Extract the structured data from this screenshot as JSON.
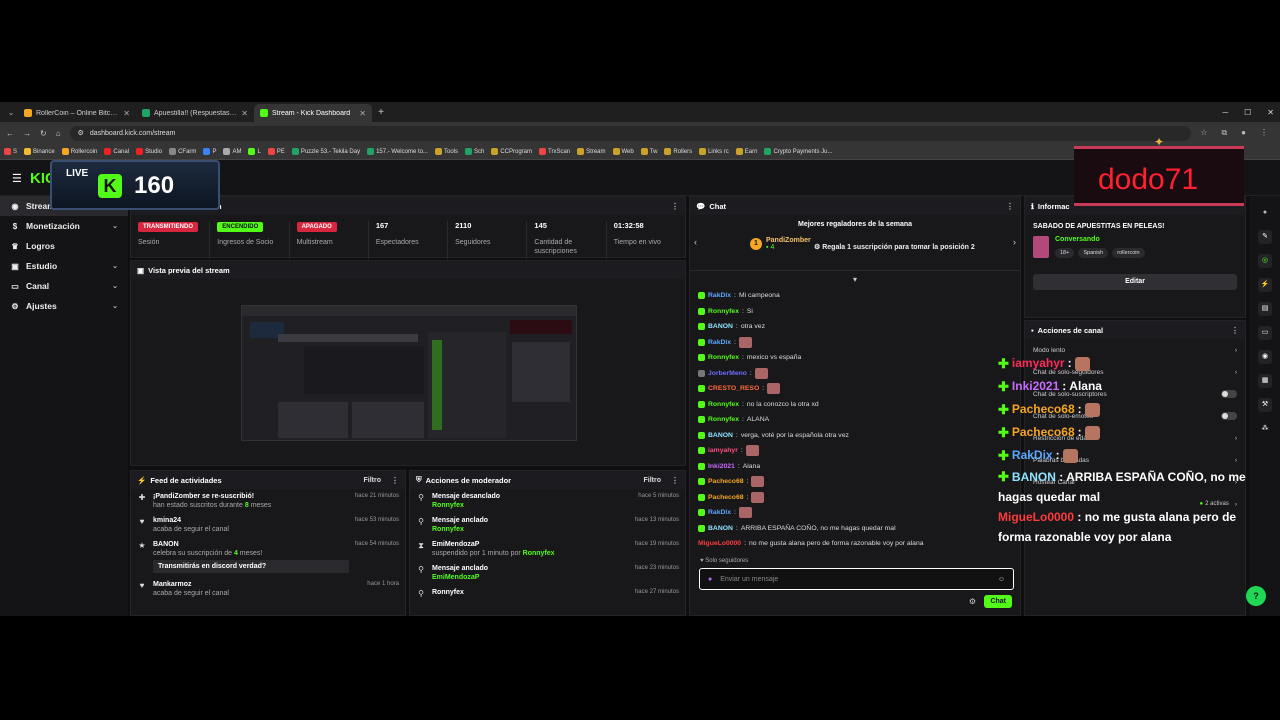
{
  "browser": {
    "tabs": [
      {
        "title": "RollerCoin – Online Bitcoin Mi",
        "color": "#f5a623",
        "active": false
      },
      {
        "title": "Apuestilla!! (Respuestas) - Hoj",
        "color": "#1fa463",
        "active": false
      },
      {
        "title": "Stream - Kick Dashboard",
        "color": "#53fc18",
        "active": true
      }
    ],
    "url": "dashboard.kick.com/stream",
    "bookmarks": [
      {
        "label": "S",
        "color": "#e44"
      },
      {
        "label": "Binance",
        "color": "#f3ba2f"
      },
      {
        "label": "Rollercoin",
        "color": "#f5a623"
      },
      {
        "label": "Canal",
        "color": "#e22"
      },
      {
        "label": "Studio",
        "color": "#e22"
      },
      {
        "label": "CFarm",
        "color": "#888"
      },
      {
        "label": "P",
        "color": "#3b82f6"
      },
      {
        "label": "AM",
        "color": "#aaa"
      },
      {
        "label": "L",
        "color": "#53fc18"
      },
      {
        "label": "PE",
        "color": "#e44"
      },
      {
        "label": "Puzzle 53.- Tekila Day",
        "color": "#1fa463"
      },
      {
        "label": "157.- Welcome to...",
        "color": "#1fa463"
      },
      {
        "label": "Tools",
        "color": "#c9a227"
      },
      {
        "label": "Sch",
        "color": "#1fa463"
      },
      {
        "label": "CCProgram",
        "color": "#c9a227"
      },
      {
        "label": "TrxScan",
        "color": "#e44"
      },
      {
        "label": "Stream",
        "color": "#c9a227"
      },
      {
        "label": "Web",
        "color": "#c9a227"
      },
      {
        "label": "Tw",
        "color": "#c9a227"
      },
      {
        "label": "Rollers",
        "color": "#c9a227"
      },
      {
        "label": "Links rc",
        "color": "#c9a227"
      },
      {
        "label": "Earn",
        "color": "#c9a227"
      },
      {
        "label": "Crypto Payments Ju...",
        "color": "#1fa463"
      }
    ]
  },
  "sidebar": {
    "items": [
      {
        "label": "Stream",
        "icon": "broadcast-icon",
        "active": true,
        "chevron": false
      },
      {
        "label": "Monetización",
        "icon": "money-icon",
        "active": false,
        "chevron": true
      },
      {
        "label": "Logros",
        "icon": "trophy-icon",
        "active": false,
        "chevron": false
      },
      {
        "label": "Estudio",
        "icon": "studio-icon",
        "active": false,
        "chevron": true
      },
      {
        "label": "Canal",
        "icon": "channel-icon",
        "active": false,
        "chevron": true
      },
      {
        "label": "Ajustes",
        "icon": "gear-icon",
        "active": false,
        "chevron": true
      }
    ]
  },
  "session": {
    "header": "n",
    "stats": [
      {
        "value": "TRANSMITIENDO",
        "pill": "red",
        "label": "Sesión"
      },
      {
        "value": "ENCENDIDO",
        "pill": "green",
        "label": "Ingresos de Socio"
      },
      {
        "value": "APAGADO",
        "pill": "red",
        "label": "Multistream"
      },
      {
        "value": "167",
        "pill": "",
        "label": "Espectadores"
      },
      {
        "value": "2110",
        "pill": "",
        "label": "Seguidores"
      },
      {
        "value": "145",
        "pill": "",
        "label": "Cantidad de suscripciones"
      },
      {
        "value": "01:32:58",
        "pill": "",
        "label": "Tiempo en vivo"
      }
    ]
  },
  "preview": {
    "title": "Vista previa del stream"
  },
  "feed": {
    "title": "Feed de actividades",
    "filter": "Filtro",
    "items": [
      {
        "icon": "gift-icon",
        "title": "¡PandiZomber se re-suscribió!",
        "sub_pre": "han estado suscritos durante ",
        "sub_hl": "8",
        "sub_post": " meses",
        "time": "hace 21 minutos",
        "quote": ""
      },
      {
        "icon": "heart-icon",
        "title": "kmina24",
        "sub_pre": "acaba de seguir el canal",
        "sub_hl": "",
        "sub_post": "",
        "time": "hace 53 minutos",
        "quote": ""
      },
      {
        "icon": "star-icon",
        "title": "BANON",
        "sub_pre": "celebra su suscripción de ",
        "sub_hl": "4",
        "sub_post": " meses!",
        "time": "hace 54 minutos",
        "quote": "Transmitirás en discord verdad?"
      },
      {
        "icon": "heart-icon",
        "title": "Mankarmoz",
        "sub_pre": "acaba de seguir el canal",
        "sub_hl": "",
        "sub_post": "",
        "time": "hace 1 hora",
        "quote": ""
      }
    ]
  },
  "modactions": {
    "title": "Acciones de moderador",
    "filter": "Filtro",
    "items": [
      {
        "icon": "unpin-icon",
        "title": "Mensaje desanclado",
        "sub_pre": "",
        "sub_hl": "Ronnyfex",
        "sub_post": "",
        "time": "hace 5 minutos"
      },
      {
        "icon": "pin-icon",
        "title": "Mensaje anclado",
        "sub_pre": "",
        "sub_hl": "Ronnyfex",
        "sub_post": "",
        "time": "hace 13 minutos"
      },
      {
        "icon": "hourglass-icon",
        "title": "EmiMendozaP",
        "sub_pre": "suspendido por 1 minuto por ",
        "sub_hl": "Ronnyfex",
        "sub_post": "",
        "time": "hace 19 minutos"
      },
      {
        "icon": "pin-icon",
        "title": "Mensaje anclado",
        "sub_pre": "",
        "sub_hl": "EmiMendozaP",
        "sub_post": "",
        "time": "hace 23 minutos"
      },
      {
        "icon": "pin-icon",
        "title": "Ronnyfex",
        "sub_pre": "",
        "sub_hl": "",
        "sub_post": "",
        "time": "hace 27 minutos"
      }
    ]
  },
  "chat": {
    "title": "Chat",
    "gifters_title": "Mejores regaladores de la semana",
    "gifter_rank": "1",
    "gifter_name": "PandiZomber",
    "gifter_count": "4",
    "gift_prompt": "Regala 1 suscripción para tomar la posición 2",
    "messages": [
      {
        "user": "RakDix",
        "color": "#5aa9ff",
        "badge": "#53fc18",
        "text": "Mi campeona",
        "emote": false
      },
      {
        "user": "Ronnyfex",
        "color": "#53fc18",
        "badge": "#53fc18",
        "text": "Si",
        "emote": false
      },
      {
        "user": "BANON",
        "color": "#8fe3ff",
        "badge": "#53fc18",
        "text": "otra vez",
        "emote": false
      },
      {
        "user": "RakDix",
        "color": "#5aa9ff",
        "badge": "#53fc18",
        "text": "",
        "emote": true
      },
      {
        "user": "Ronnyfex",
        "color": "#53fc18",
        "badge": "#53fc18",
        "text": "mexico vs españa",
        "emote": false
      },
      {
        "user": "JorberMeno",
        "color": "#6c6cff",
        "badge": "#777",
        "text": "",
        "emote": true
      },
      {
        "user": "CRESTO_RESO",
        "color": "#ff6a3d",
        "badge": "#53fc18",
        "text": "",
        "emote": true
      },
      {
        "user": "Ronnyfex",
        "color": "#53fc18",
        "badge": "#53fc18",
        "text": "no la conozco la otra xd",
        "emote": false
      },
      {
        "user": "Ronnyfex",
        "color": "#53fc18",
        "badge": "#53fc18",
        "text": "ALANA",
        "emote": false
      },
      {
        "user": "BANON",
        "color": "#8fe3ff",
        "badge": "#53fc18",
        "text": "verga, voté por la española otra vez",
        "emote": false
      },
      {
        "user": "iamyahyr",
        "color": "#ff4d7a",
        "badge": "#53fc18",
        "text": "",
        "emote": true
      },
      {
        "user": "Inki2021",
        "color": "#c86bff",
        "badge": "#53fc18",
        "text": "Alana",
        "emote": false
      },
      {
        "user": "Pacheco68",
        "color": "#f5a623",
        "badge": "#53fc18",
        "text": "",
        "emote": true
      },
      {
        "user": "Pacheco68",
        "color": "#f5a623",
        "badge": "#53fc18",
        "text": "",
        "emote": true
      },
      {
        "user": "RakDix",
        "color": "#5aa9ff",
        "badge": "#53fc18",
        "text": "",
        "emote": true
      },
      {
        "user": "BANON",
        "color": "#8fe3ff",
        "badge": "#53fc18",
        "text": "ARRIBA ESPAÑA COÑO, no me hagas quedar mal",
        "emote": false
      },
      {
        "user": "MigueLo0000",
        "color": "#ff3b3b",
        "badge": "",
        "text": "no me gusta alana pero de forma razonable voy por alana",
        "emote": false
      }
    ],
    "solo_label": "Solo seguidores",
    "input_placeholder": "Enviar un mensaje",
    "send_label": "Chat"
  },
  "info": {
    "header": "Informac",
    "stream_title": "SABADO DE APUESTITAS EN PELEAS!",
    "category": "Conversando",
    "tags": [
      "18+",
      "Spanish",
      "rollercoin"
    ],
    "edit_label": "Editar"
  },
  "channel_actions": {
    "title": "Acciones de canal",
    "rows": [
      "Modo lento",
      "Chat de solo-seguidores",
      "Chat de solo-suscriptores",
      "Chat de solo-emotes",
      "Restricción de edad",
      "Palabras baneadas",
      "Hostear Canal"
    ],
    "active_count": "2 activas"
  },
  "overlays": {
    "live_label": "LIVE",
    "viewer_count": "160",
    "streamer_name": "dodo71",
    "chat": [
      {
        "user": "iamyahyr",
        "color": "#ff2a5a",
        "text": "",
        "face": true
      },
      {
        "user": "Inki2021",
        "color": "#c86bff",
        "text": "Alana",
        "face": false
      },
      {
        "user": "Pacheco68",
        "color": "#f5a623",
        "text": "",
        "face": true
      },
      {
        "user": "Pacheco68",
        "color": "#f5a623",
        "text": "",
        "face": true
      },
      {
        "user": "RakDix",
        "color": "#5aa9ff",
        "text": "",
        "face": true
      },
      {
        "user": "BANON",
        "color": "#8fe3ff",
        "text": "ARRIBA ESPAÑA COÑO, no me hagas quedar mal",
        "face": false
      },
      {
        "user": "MigueLo0000",
        "color": "#ff3b3b",
        "text": "no me gusta alana pero de forma razonable voy por alana",
        "face": false
      }
    ]
  }
}
